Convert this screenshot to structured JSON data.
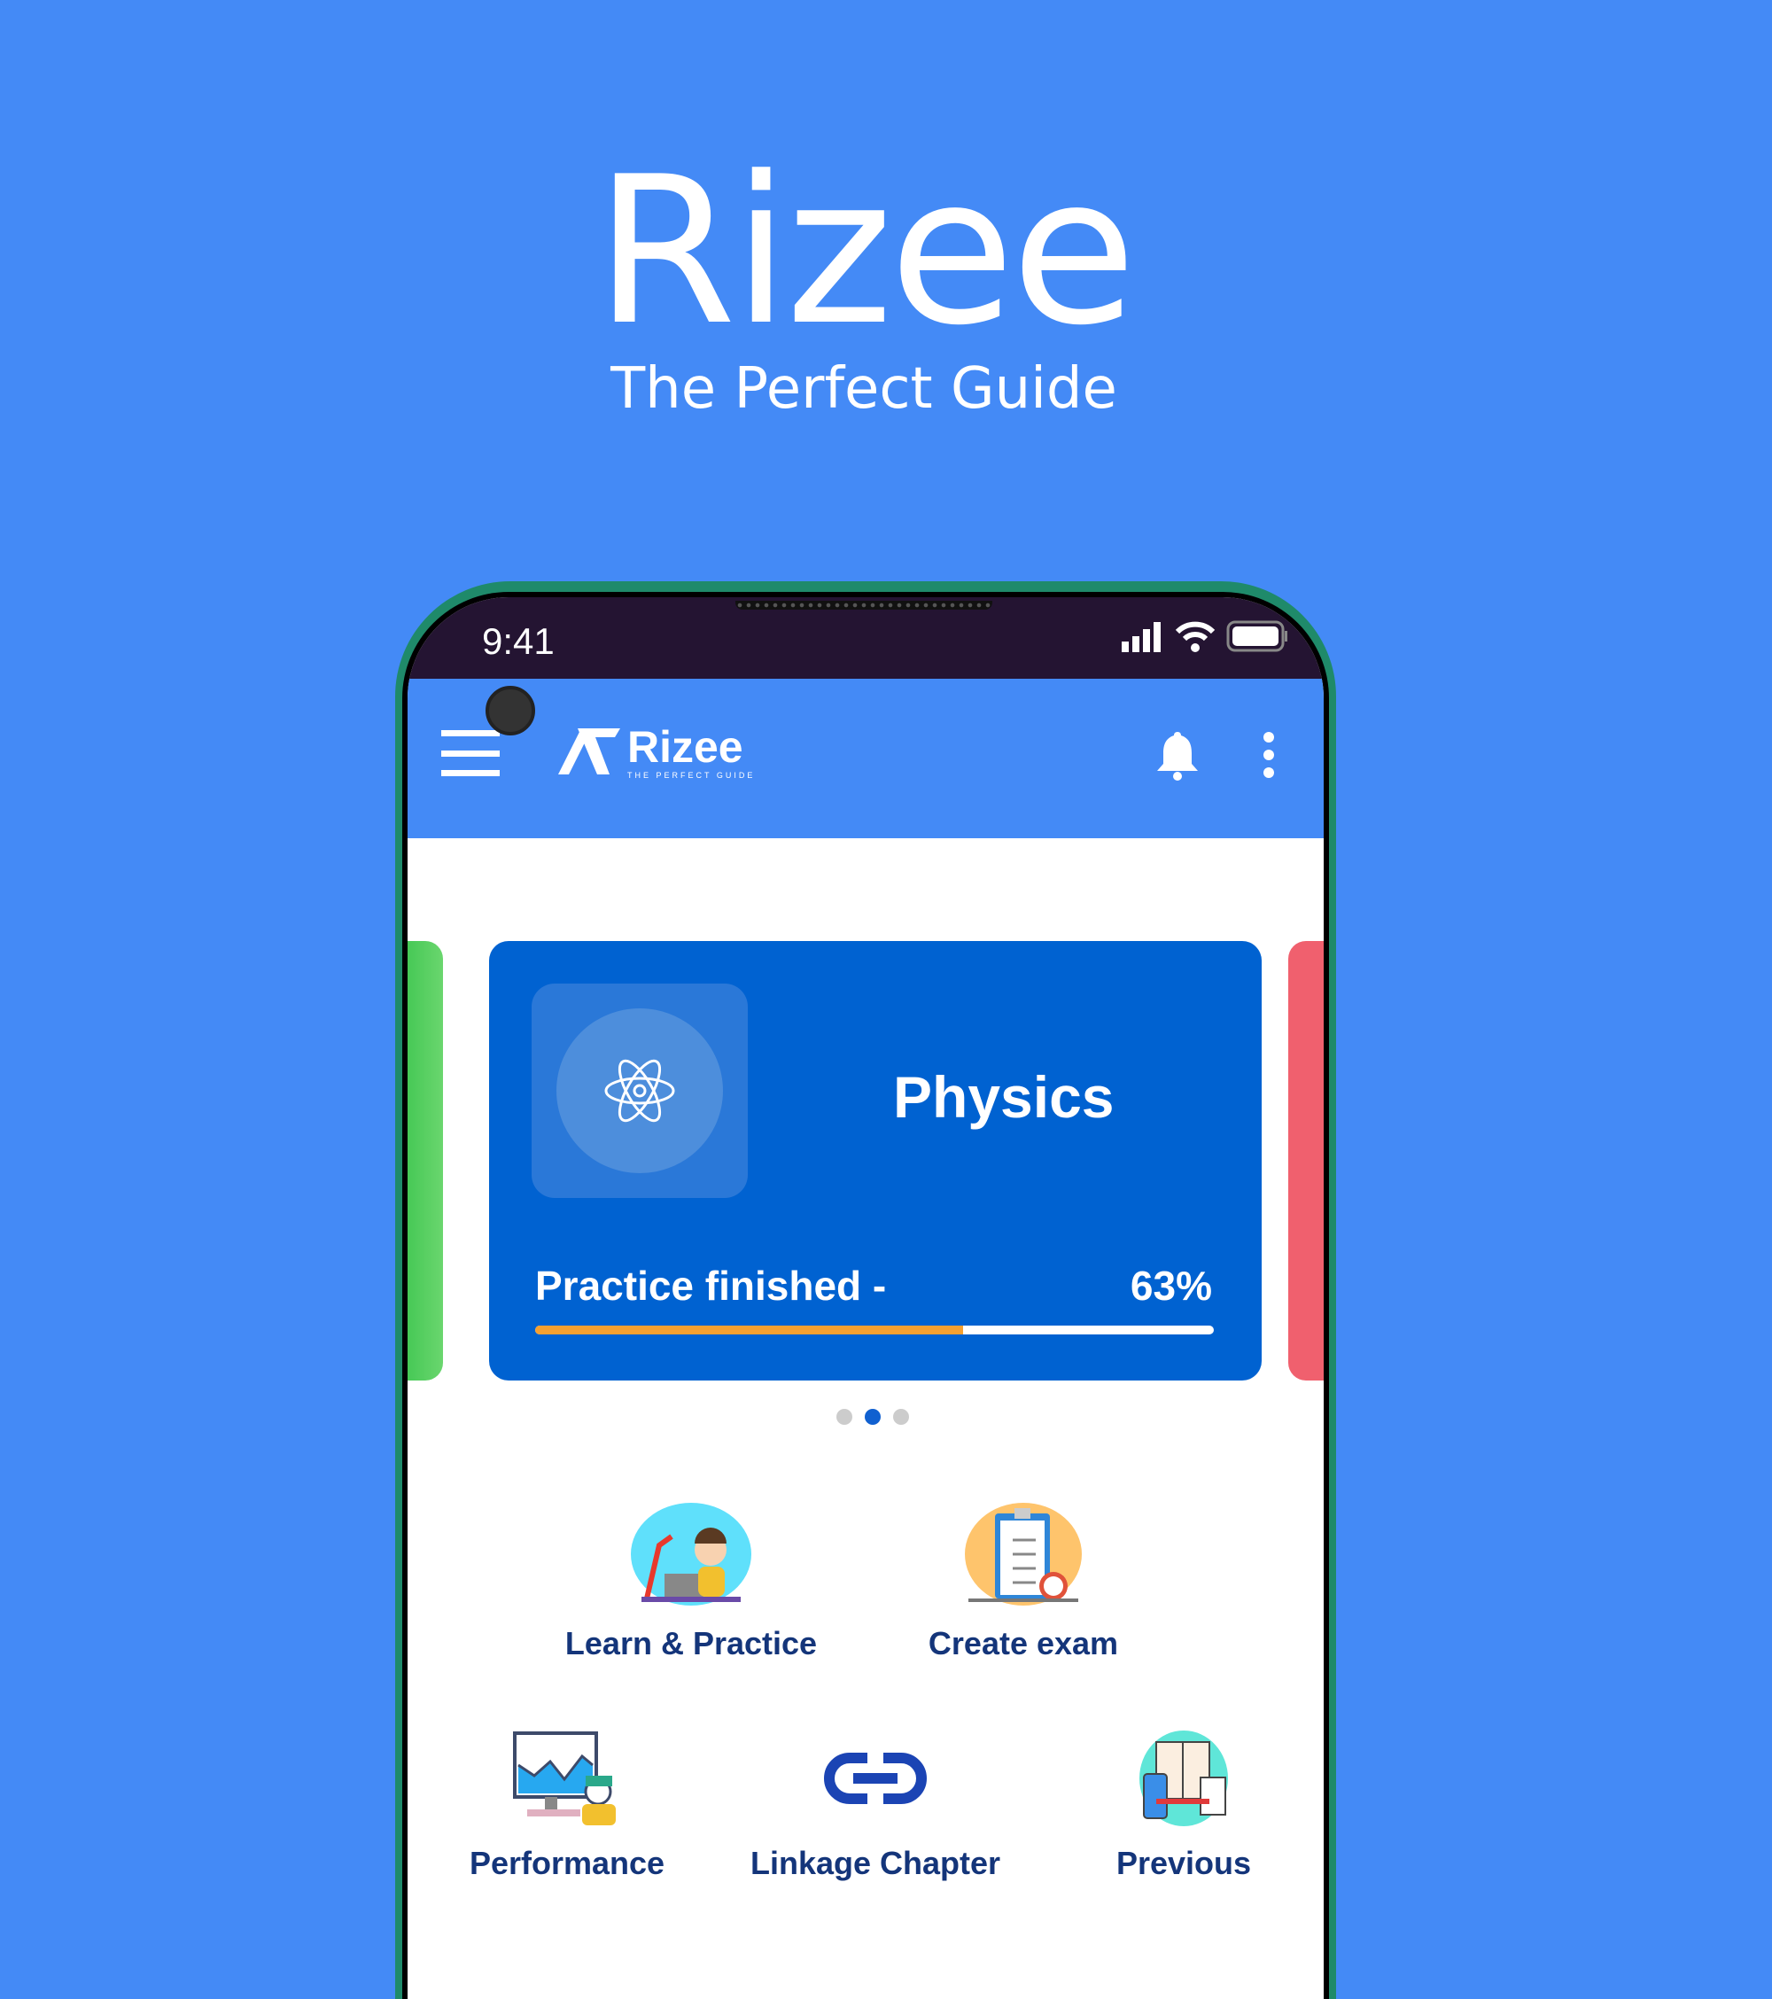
{
  "hero": {
    "title": "Rizee",
    "subtitle": "The Perfect Guide"
  },
  "status_bar": {
    "time": "9:41"
  },
  "header": {
    "logo_word": "Rizee",
    "logo_tagline": "THE PERFECT GUIDE"
  },
  "card": {
    "subject": "Physics",
    "progress_label": "Practice finished -",
    "progress_text": "63%",
    "progress_value": 63,
    "icon": "atom-icon"
  },
  "carousel": {
    "pages": 3,
    "active": 2
  },
  "tiles": [
    {
      "label": "Learn & Practice",
      "icon": "student-laptop-illustration"
    },
    {
      "label": "Create exam",
      "icon": "test-clipboard-illustration"
    },
    {
      "label": "Performance",
      "icon": "performance-chart-illustration"
    },
    {
      "label": "Linkage Chapter",
      "icon": "link-icon"
    },
    {
      "label": "Previous",
      "icon": "books-illustration"
    }
  ],
  "colors": {
    "background": "#448af6",
    "card": "#0062d1",
    "status_bar": "#241432",
    "progress": "#f5a030",
    "label": "#14357a"
  }
}
